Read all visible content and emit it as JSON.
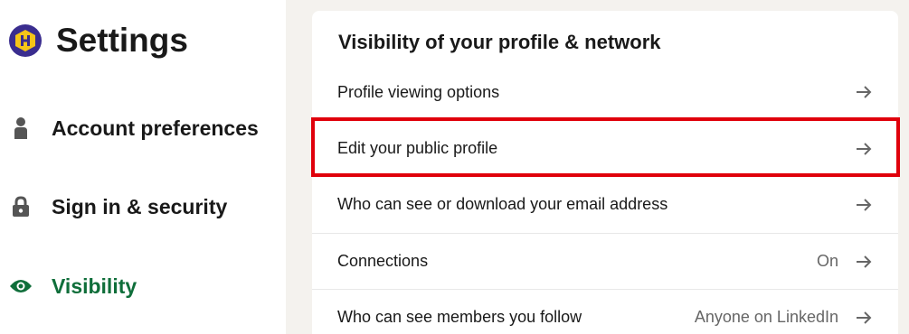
{
  "header": {
    "title": "Settings",
    "avatar_icon": "hexagon-h-icon"
  },
  "sidebar": {
    "items": [
      {
        "label": "Account preferences",
        "icon": "person-icon",
        "active": false
      },
      {
        "label": "Sign in & security",
        "icon": "lock-icon",
        "active": false
      },
      {
        "label": "Visibility",
        "icon": "eye-icon",
        "active": true
      }
    ]
  },
  "card": {
    "title": "Visibility of your profile & network",
    "rows": [
      {
        "label": "Profile viewing options",
        "value": ""
      },
      {
        "label": "Edit your public profile",
        "value": ""
      },
      {
        "label": "Who can see or download your email address",
        "value": ""
      },
      {
        "label": "Connections",
        "value": "On"
      },
      {
        "label": "Who can see members you follow",
        "value": "Anyone on LinkedIn"
      }
    ]
  },
  "colors": {
    "active": "#0f6e3a",
    "highlight": "#e0000b",
    "background": "#f4f2ee"
  }
}
